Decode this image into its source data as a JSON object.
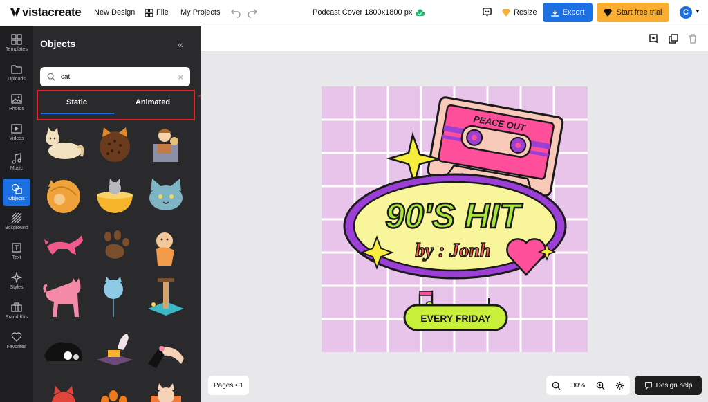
{
  "header": {
    "brand": "vistacreate",
    "menu": {
      "new_design": "New Design",
      "file": "File",
      "my_projects": "My Projects"
    },
    "document_title": "Podcast Cover 1800x1800 px",
    "resize": "Resize",
    "export": "Export",
    "trial": "Start free trial",
    "avatar": "C",
    "accent": "#1b6fe0",
    "trial_color": "#f9ad31"
  },
  "rail": {
    "items": [
      {
        "label": "Templates",
        "icon": "templates-icon"
      },
      {
        "label": "Uploads",
        "icon": "folder-icon"
      },
      {
        "label": "Photos",
        "icon": "image-icon"
      },
      {
        "label": "Videos",
        "icon": "play-icon"
      },
      {
        "label": "Music",
        "icon": "music-icon"
      },
      {
        "label": "Objects",
        "icon": "shapes-icon",
        "active": true
      },
      {
        "label": "Bckground",
        "icon": "stripes-icon"
      },
      {
        "label": "Text",
        "icon": "text-icon"
      },
      {
        "label": "Styles",
        "icon": "sparkle-icon"
      },
      {
        "label": "Brand Kits",
        "icon": "briefcase-icon"
      },
      {
        "label": "Favorites",
        "icon": "heart-icon"
      }
    ]
  },
  "panel": {
    "title": "Objects",
    "search_value": "cat",
    "tabs": [
      {
        "label": "Static",
        "active": true
      },
      {
        "label": "Animated",
        "active": false
      }
    ]
  },
  "design": {
    "cassette_label": "PEACE OUT",
    "headline": "90'S HIT",
    "byline": "by : Jonh",
    "badge": "EVERY FRIDAY"
  },
  "footer": {
    "pages": "Pages • 1",
    "zoom": "30%",
    "design_help": "Design help"
  }
}
